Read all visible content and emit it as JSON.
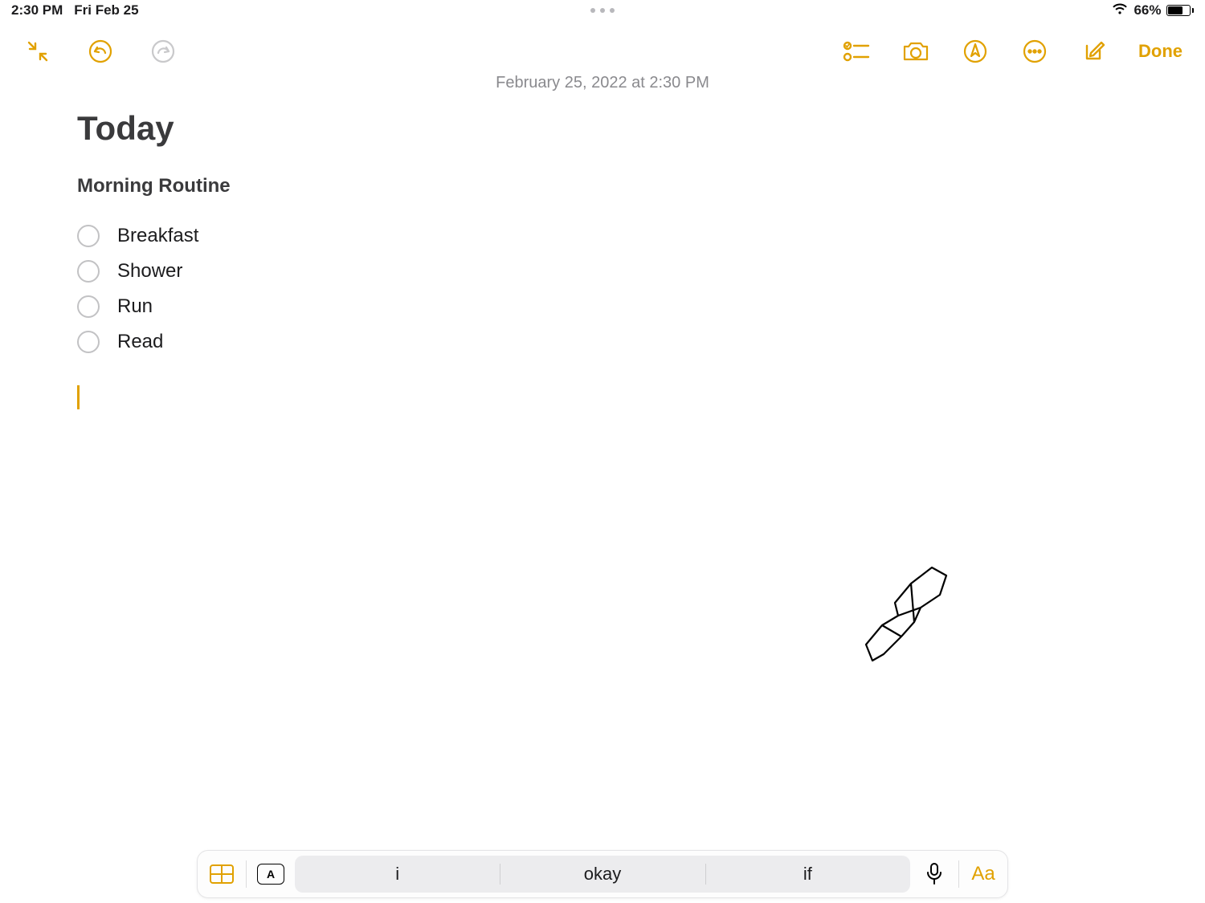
{
  "status": {
    "time": "2:30 PM",
    "date": "Fri Feb 25",
    "battery_pct": "66%"
  },
  "note": {
    "timestamp": "February 25, 2022 at 2:30 PM",
    "title": "Today",
    "subtitle": "Morning Routine",
    "items": [
      "Breakfast",
      "Shower",
      "Run",
      "Read"
    ]
  },
  "toolbar": {
    "done": "Done"
  },
  "keyboard": {
    "lang": "A",
    "suggestions": [
      "i",
      "okay",
      "if"
    ],
    "format": "Aa"
  },
  "colors": {
    "accent": "#e1a100"
  }
}
